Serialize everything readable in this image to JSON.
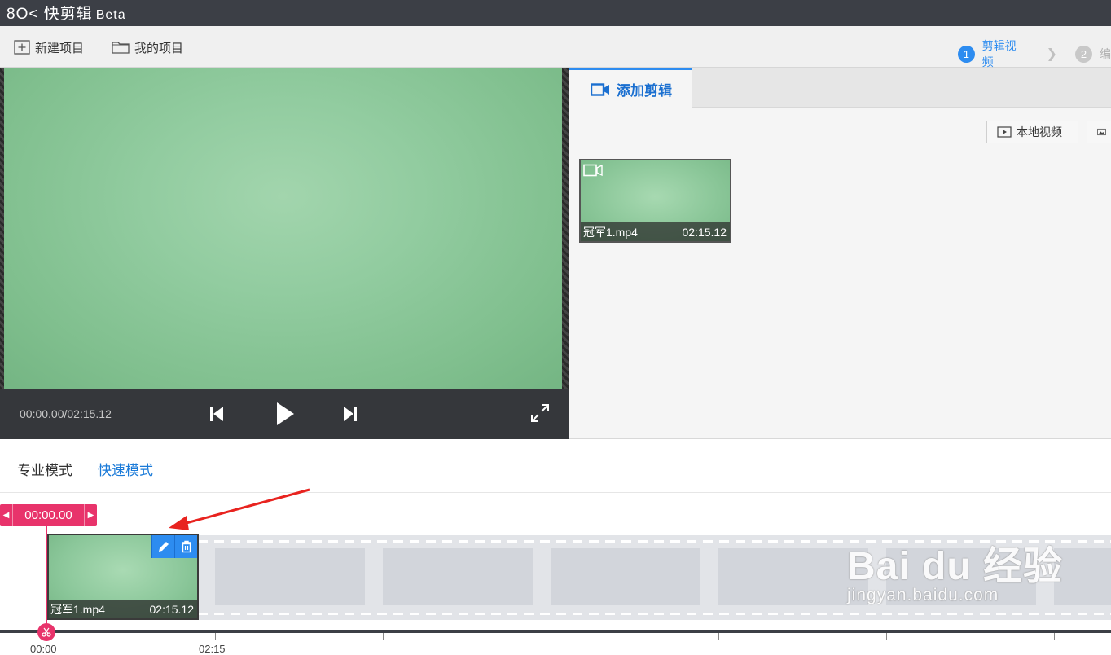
{
  "app": {
    "logo_text": "8O< 快剪辑",
    "beta_label": "Beta"
  },
  "toolbar": {
    "new_project_label": "新建项目",
    "my_projects_label": "我的项目"
  },
  "steps": [
    {
      "number": "1",
      "label": "剪辑视频"
    },
    {
      "number": "2",
      "label": "编"
    }
  ],
  "preview": {
    "timecode": "00:00.00/02:15.12"
  },
  "right_panel": {
    "tab_label": "添加剪辑",
    "local_video_label": "本地视频",
    "clip": {
      "name": "冠军1.mp4",
      "duration": "02:15.12"
    }
  },
  "modes": {
    "pro_label": "专业模式",
    "fast_label": "快速模式"
  },
  "timeline": {
    "playhead_time": "00:00.00",
    "clip": {
      "name": "冠军1.mp4",
      "duration": "02:15.12"
    },
    "ruler_labels": [
      "00:00",
      "02:15"
    ]
  },
  "watermark": {
    "logo": "Bai du 经验",
    "url": "jingyan.baidu.com"
  },
  "colors": {
    "accent": "#2d8cf0",
    "playhead": "#e8336b",
    "titlebar": "#3c3f46"
  }
}
